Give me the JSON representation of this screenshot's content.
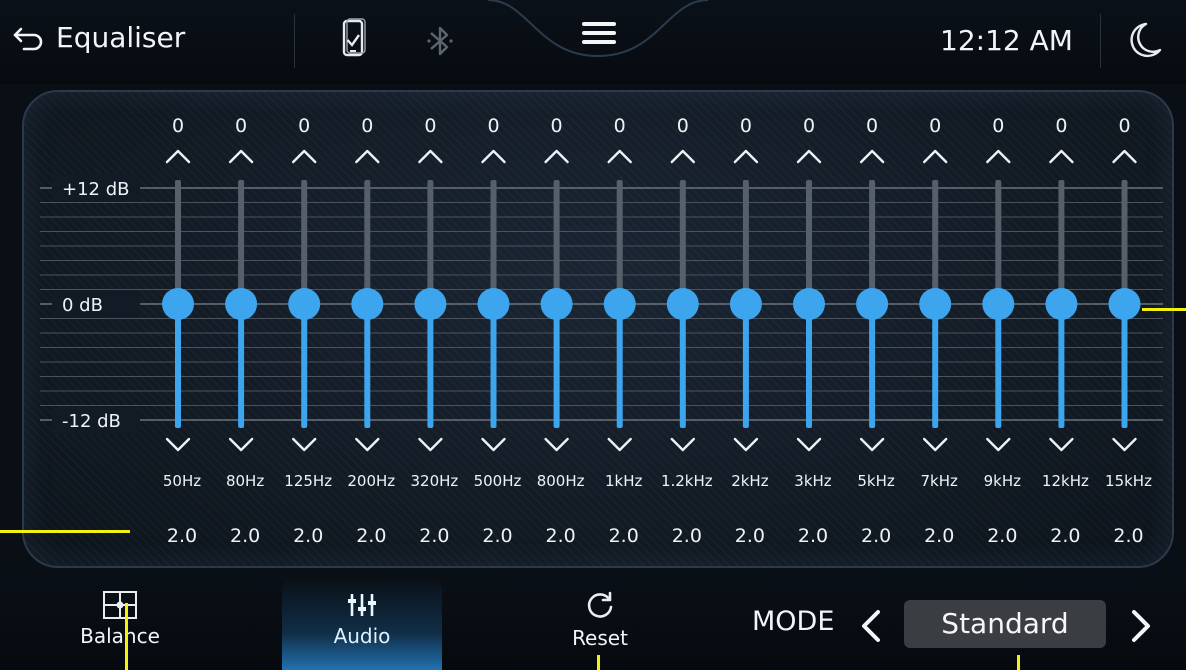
{
  "header": {
    "back_icon": "back-arrow-icon",
    "title": "Equaliser",
    "phone_link_icon": "phone-link-icon",
    "bluetooth_icon": "bluetooth-icon",
    "menu_icon": "menu-icon",
    "time": "12:12 AM",
    "night_mode_icon": "moon-icon"
  },
  "equaliser": {
    "scale_labels": [
      "+12 dB",
      "0 dB",
      "-12 dB"
    ],
    "range_db": [
      -12,
      12
    ],
    "bands": [
      {
        "freq": "50Hz",
        "gain": "0",
        "q": "2.0"
      },
      {
        "freq": "80Hz",
        "gain": "0",
        "q": "2.0"
      },
      {
        "freq": "125Hz",
        "gain": "0",
        "q": "2.0"
      },
      {
        "freq": "200Hz",
        "gain": "0",
        "q": "2.0"
      },
      {
        "freq": "320Hz",
        "gain": "0",
        "q": "2.0"
      },
      {
        "freq": "500Hz",
        "gain": "0",
        "q": "2.0"
      },
      {
        "freq": "800Hz",
        "gain": "0",
        "q": "2.0"
      },
      {
        "freq": "1kHz",
        "gain": "0",
        "q": "2.0"
      },
      {
        "freq": "1.2kHz",
        "gain": "0",
        "q": "2.0"
      },
      {
        "freq": "2kHz",
        "gain": "0",
        "q": "2.0"
      },
      {
        "freq": "3kHz",
        "gain": "0",
        "q": "2.0"
      },
      {
        "freq": "5kHz",
        "gain": "0",
        "q": "2.0"
      },
      {
        "freq": "7kHz",
        "gain": "0",
        "q": "2.0"
      },
      {
        "freq": "9kHz",
        "gain": "0",
        "q": "2.0"
      },
      {
        "freq": "12kHz",
        "gain": "0",
        "q": "2.0"
      },
      {
        "freq": "15kHz",
        "gain": "0",
        "q": "2.0"
      }
    ],
    "up_icon": "chevron-up-icon",
    "down_icon": "chevron-down-icon",
    "slider_color": "#3da4ee"
  },
  "footer": {
    "balance_label": "Balance",
    "balance_icon": "balance-grid-icon",
    "audio_label": "Audio",
    "audio_icon": "sliders-icon",
    "reset_label": "Reset",
    "reset_icon": "reset-icon",
    "mode_label": "MODE",
    "mode_value": "Standard",
    "mode_prev_icon": "chevron-left-icon",
    "mode_next_icon": "chevron-right-icon",
    "active_tab": "Audio"
  },
  "colors": {
    "accent": "#3da4ee",
    "annotation": "#f5f10f",
    "background": "#0a0f16"
  }
}
